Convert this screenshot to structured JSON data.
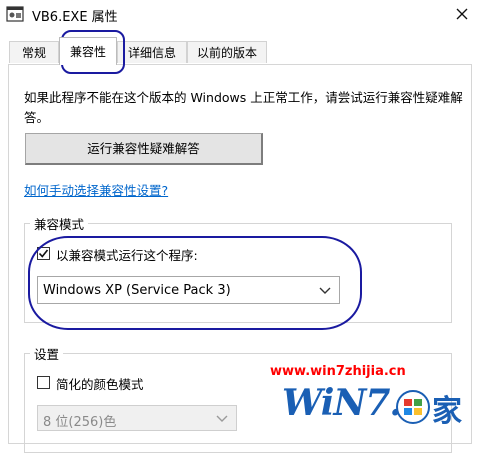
{
  "window": {
    "title": "VB6.EXE 属性"
  },
  "tabs": [
    {
      "label": "常规"
    },
    {
      "label": "兼容性"
    },
    {
      "label": "详细信息"
    },
    {
      "label": "以前的版本"
    }
  ],
  "compat": {
    "description": "如果此程序不能在这个版本的 Windows 上正常工作，请尝试运行兼容性疑难解答。",
    "troubleshoot_button": "运行兼容性疑难解答",
    "manual_link": "如何手动选择兼容性设置?",
    "mode_group_label": "兼容模式",
    "mode_checkbox_label": "以兼容模式运行这个程序:",
    "mode_checked": true,
    "mode_select_value": "Windows XP (Service Pack 3)"
  },
  "settings": {
    "group_label": "设置",
    "reduced_color_label": "简化的颜色模式",
    "reduced_color_checked": false,
    "color_select_value": "8 位(256)色"
  },
  "watermark": {
    "url": "www.win7zhijia.cn",
    "logo_text": "WiN7.",
    "logo_suffix": "家"
  },
  "colors": {
    "annotation": "#1a1aa0",
    "link": "#0066cc",
    "watermark_red": "#ff0000",
    "watermark_blue": "#1a5fb4"
  }
}
